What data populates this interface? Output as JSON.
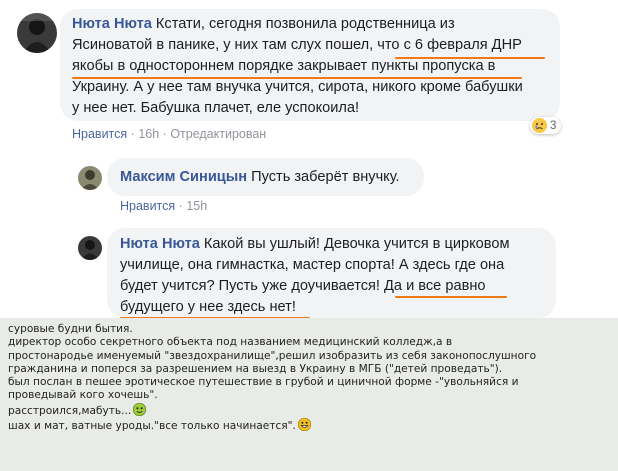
{
  "comments": [
    {
      "author": "Нюта Нюта",
      "lines": [
        "Кстати, сегодня позвонила родственница из",
        "Ясиноватой в панике, у них там слух пошел, что с 6 февраля ДНР",
        "якобы в одностороннем порядке закрывает пункты пропуска в",
        "Украину. А у нее там внучка учится, сирота, никого кроме бабушки",
        "у нее нет. Бабушка плачет, еле успокоила!"
      ],
      "like_label": "Нравится",
      "time": "16h",
      "edited": "Отредактирован",
      "reaction_count": "3"
    },
    {
      "author": "Максим Синицын",
      "text": "Пусть заберёт внучку.",
      "like_label": "Нравится",
      "time": "15h"
    },
    {
      "author": "Нюта Нюта",
      "lines": [
        "Какой вы ушлый! Девочка учится в цирковом",
        "училище, она гимнастка, мастер спорта! А здесь где она",
        "будет учится? Пусть уже доучивается! Да и все равно",
        "будущего у нее здесь нет!"
      ]
    }
  ],
  "separator": "·",
  "post_lines": [
    "суровые будни бытия.",
    "директор особо секретного объекта под названием медицинский колледж,а в",
    "простонародье именуемый \"звездохранилище\",решил изобразить из себя законопослушного",
    "гражданина и поперся за разрешением на выезд в Украину в МГБ (\"детей проведать\").",
    "был послан в пешее эротическое путешествие в грубой и циничной форме -\"увольняйся и",
    "проведывай кого хочешь\".",
    "расстроился,мабуть...",
    "шах и мат, ватные уроды.\"все только начинается\"."
  ],
  "colors": {
    "link": "#385898",
    "meta": "#90949c",
    "bubble": "#f2f3f5",
    "underline": "#f07a1a",
    "bottom_bg": "#e9ece6"
  },
  "icons": {
    "reaction": "sad-face-emoji",
    "smile1": "green-smiley-emoji",
    "smile2": "grinning-smiley-emoji"
  }
}
